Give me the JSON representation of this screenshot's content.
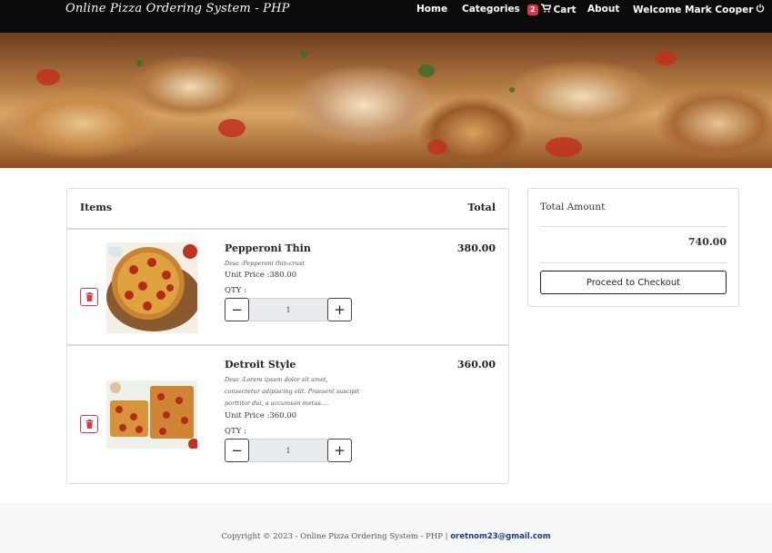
{
  "navbar": {
    "brand": "Online Pizza Ordering System - PHP",
    "home": "Home",
    "categories": "Categories",
    "cart_count": "2",
    "cart": "Cart",
    "about": "About",
    "welcome": "Welcome Mark Cooper"
  },
  "cart": {
    "header": {
      "items": "Items",
      "total": "Total"
    },
    "items": [
      {
        "name": "Pepperoni Thin",
        "desc": "Desc :Pepperoni thin-crust",
        "unit_price": "Unit Price :380.00",
        "qty_label": "QTY :",
        "qty": "1",
        "total": "380.00"
      },
      {
        "name": "Detroit Style",
        "desc": "Desc :Lorem ipsum dolor sit amet, consectetur adipiscing elit. Praesent suscipit porttitor dui, a accumsan metus....",
        "unit_price": "Unit Price :360.00",
        "qty_label": "QTY :",
        "qty": "1",
        "total": "360.00"
      }
    ]
  },
  "summary": {
    "title": "Total Amount",
    "amount": "740.00",
    "checkout": "Proceed to Checkout"
  },
  "footer": {
    "copyright": "Copyright © 2023 - Online Pizza Ordering System - PHP | ",
    "email": "oretnom23@gmail.com"
  },
  "colors": {
    "navbar_bg": "#0b0b0b",
    "danger": "#dc3545",
    "footer_bg": "#f7f8f9",
    "email_link": "#1e3a8a"
  },
  "icons": [
    "cart-icon",
    "power-icon",
    "trash-icon",
    "minus-icon",
    "plus-icon"
  ]
}
